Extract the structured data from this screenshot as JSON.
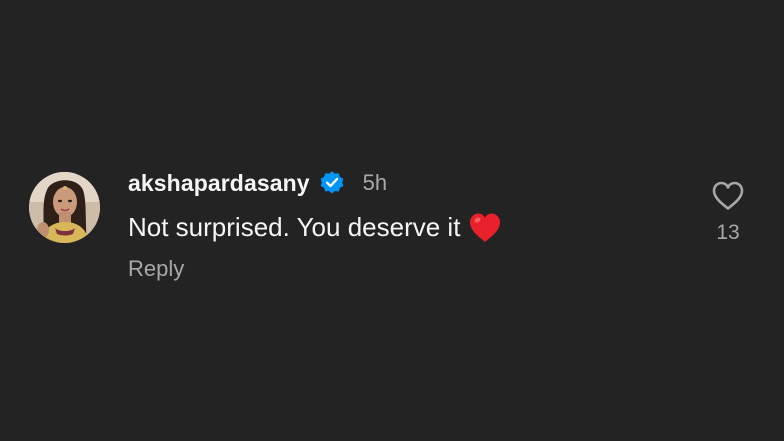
{
  "comment": {
    "username": "akshapardasany",
    "verified": true,
    "verified_icon": "verified-badge-icon",
    "timestamp": "5h",
    "text": "Not surprised. You deserve it",
    "emoji": "red-heart-emoji",
    "reply_label": "Reply",
    "like_icon": "heart-outline-icon",
    "like_count": "13"
  },
  "colors": {
    "background": "#232323",
    "primary_text": "#f5f5f5",
    "secondary_text": "#a8a8a8",
    "verified_blue": "#0095f6",
    "emoji_red": "#e8202a"
  }
}
